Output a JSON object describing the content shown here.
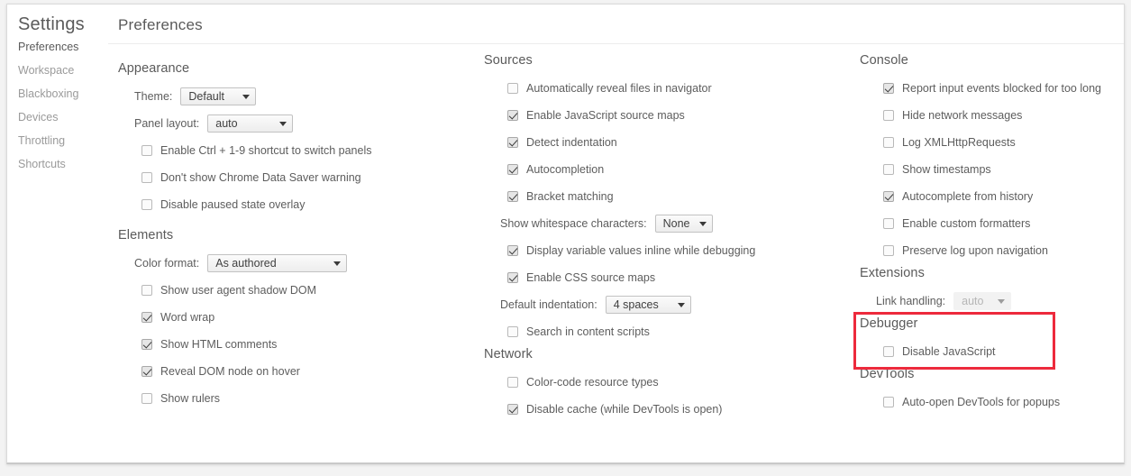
{
  "window": {
    "sidebar_title": "Settings",
    "content_header": "Preferences"
  },
  "sidebar": {
    "items": [
      {
        "label": "Preferences",
        "selected": true
      },
      {
        "label": "Workspace",
        "selected": false
      },
      {
        "label": "Blackboxing",
        "selected": false
      },
      {
        "label": "Devices",
        "selected": false
      },
      {
        "label": "Throttling",
        "selected": false
      },
      {
        "label": "Shortcuts",
        "selected": false
      }
    ]
  },
  "colors": {
    "highlight_red": "#ed2a3c",
    "text_primary": "#5d5d5d",
    "text_muted": "#9a9a9a",
    "divider": "#ececec"
  },
  "sections": {
    "appearance": {
      "title": "Appearance",
      "theme_label": "Theme:",
      "theme_value": "Default",
      "panel_layout_label": "Panel layout:",
      "panel_layout_value": "auto",
      "checkboxes": [
        {
          "label": "Enable Ctrl + 1-9 shortcut to switch panels",
          "checked": false
        },
        {
          "label": "Don't show Chrome Data Saver warning",
          "checked": false
        },
        {
          "label": "Disable paused state overlay",
          "checked": false
        }
      ]
    },
    "elements": {
      "title": "Elements",
      "color_format_label": "Color format:",
      "color_format_value": "As authored",
      "checkboxes": [
        {
          "label": "Show user agent shadow DOM",
          "checked": false
        },
        {
          "label": "Word wrap",
          "checked": true
        },
        {
          "label": "Show HTML comments",
          "checked": true
        },
        {
          "label": "Reveal DOM node on hover",
          "checked": true
        },
        {
          "label": "Show rulers",
          "checked": false
        }
      ]
    },
    "sources": {
      "title": "Sources",
      "checkboxes_top": [
        {
          "label": "Automatically reveal files in navigator",
          "checked": false
        },
        {
          "label": "Enable JavaScript source maps",
          "checked": true
        },
        {
          "label": "Detect indentation",
          "checked": true
        },
        {
          "label": "Autocompletion",
          "checked": true
        },
        {
          "label": "Bracket matching",
          "checked": true
        }
      ],
      "whitespace_label": "Show whitespace characters:",
      "whitespace_value": "None",
      "checkboxes_mid": [
        {
          "label": "Display variable values inline while debugging",
          "checked": true
        },
        {
          "label": "Enable CSS source maps",
          "checked": true
        }
      ],
      "indentation_label": "Default indentation:",
      "indentation_value": "4 spaces",
      "checkboxes_bottom": [
        {
          "label": "Search in content scripts",
          "checked": false
        }
      ]
    },
    "network": {
      "title": "Network",
      "checkboxes": [
        {
          "label": "Color-code resource types",
          "checked": false
        },
        {
          "label": "Disable cache (while DevTools is open)",
          "checked": true
        }
      ]
    },
    "console": {
      "title": "Console",
      "checkboxes": [
        {
          "label": "Report input events blocked for too long",
          "checked": true
        },
        {
          "label": "Hide network messages",
          "checked": false
        },
        {
          "label": "Log XMLHttpRequests",
          "checked": false
        },
        {
          "label": "Show timestamps",
          "checked": false
        },
        {
          "label": "Autocomplete from history",
          "checked": true
        },
        {
          "label": "Enable custom formatters",
          "checked": false
        },
        {
          "label": "Preserve log upon navigation",
          "checked": false
        }
      ]
    },
    "extensions": {
      "title": "Extensions",
      "link_handling_label": "Link handling:",
      "link_handling_value": "auto",
      "link_handling_disabled": true
    },
    "debugger": {
      "title": "Debugger",
      "checkboxes": [
        {
          "label": "Disable JavaScript",
          "checked": false
        }
      ]
    },
    "devtools": {
      "title": "DevTools",
      "checkboxes": [
        {
          "label": "Auto-open DevTools for popups",
          "checked": false
        }
      ]
    }
  }
}
